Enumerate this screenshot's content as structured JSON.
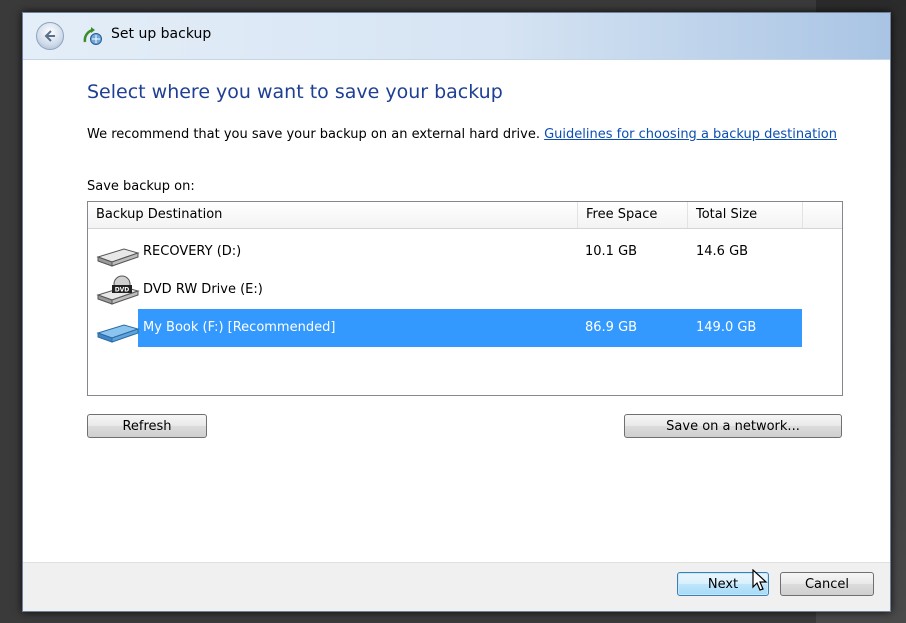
{
  "window": {
    "title": "Set up backup",
    "back_icon": "back-arrow-icon",
    "app_icon": "backup-icon"
  },
  "main": {
    "heading": "Select where you want to save your backup",
    "description": "We recommend that you save your backup on an external hard drive.",
    "guidelines_link": "Guidelines for choosing a backup destination",
    "save_label": "Save backup on:"
  },
  "table": {
    "columns": [
      "Backup Destination",
      "Free Space",
      "Total Size"
    ],
    "rows": [
      {
        "name": "RECOVERY (D:)",
        "free": "10.1 GB",
        "total": "14.6 GB",
        "icon": "hard-drive-icon",
        "selected": false
      },
      {
        "name": "DVD RW Drive (E:)",
        "free": "",
        "total": "",
        "icon": "dvd-drive-icon",
        "selected": false
      },
      {
        "name": "My Book (F:) [Recommended]",
        "free": "86.9 GB",
        "total": "149.0 GB",
        "icon": "external-drive-icon",
        "selected": true
      }
    ]
  },
  "buttons": {
    "refresh": "Refresh",
    "network": "Save on a network...",
    "next": "Next",
    "cancel": "Cancel"
  },
  "colors": {
    "heading": "#1e3f93",
    "link": "#0b4fb3",
    "selection": "#3399ff"
  }
}
